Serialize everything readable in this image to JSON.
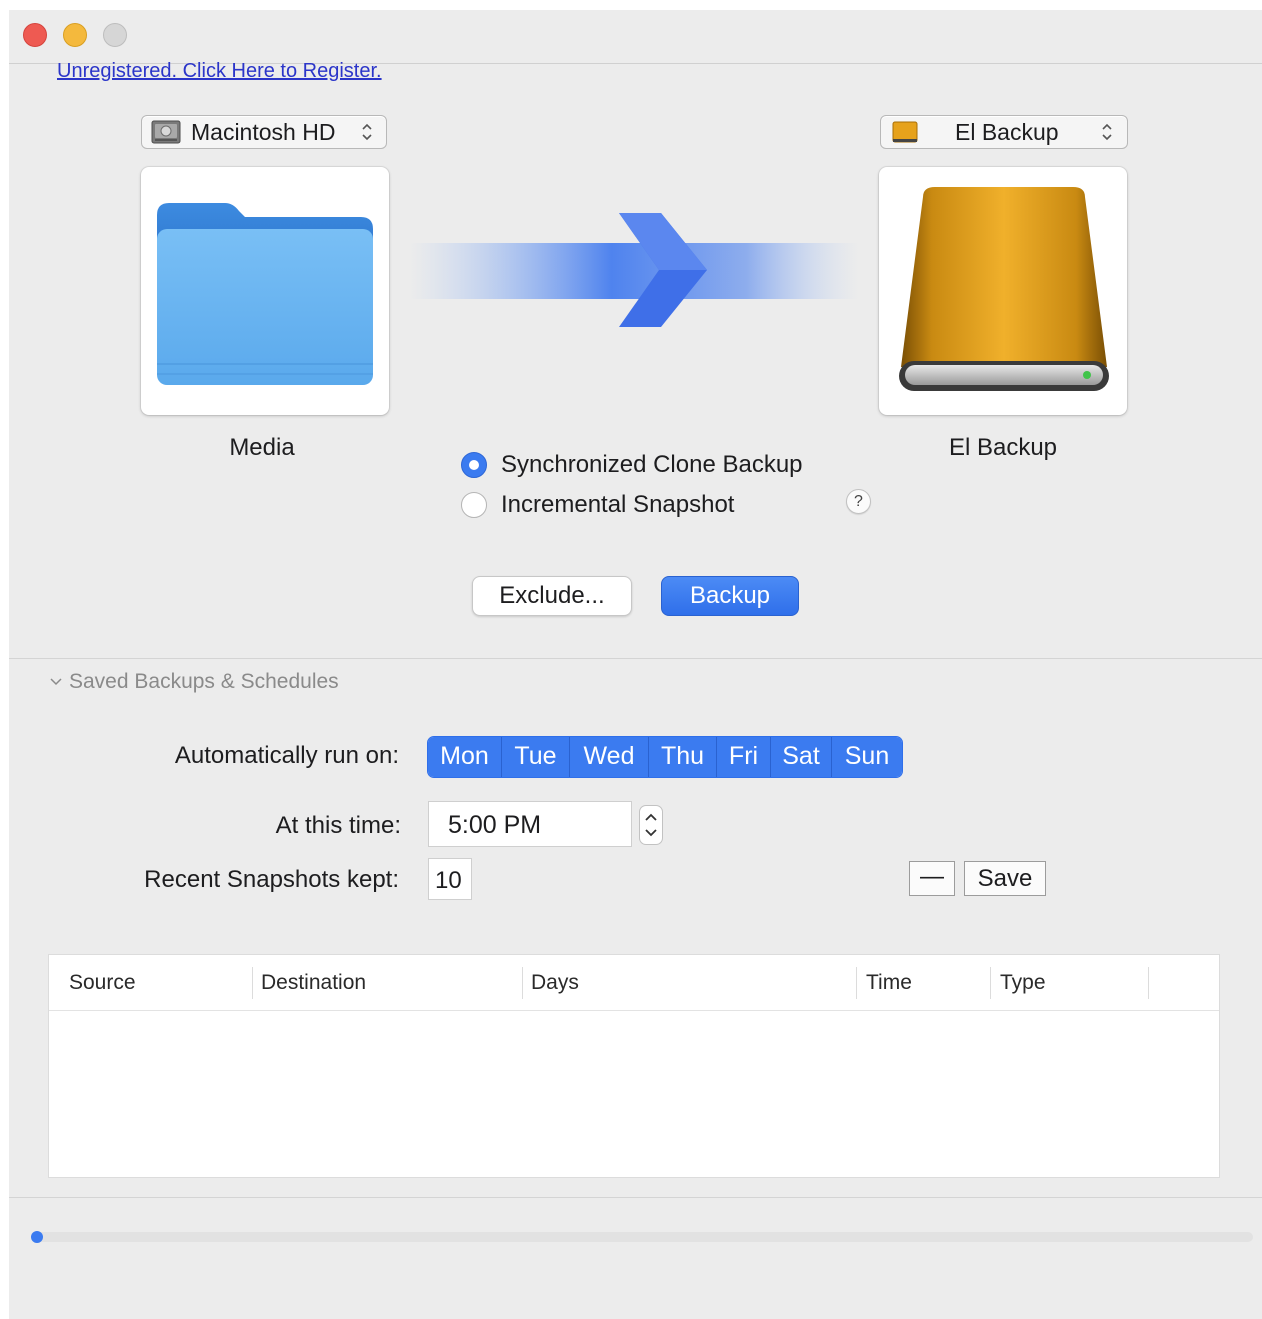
{
  "register_link": "Unregistered. Click Here to Register.",
  "source": {
    "popup_label": "Macintosh HD",
    "name": "Media",
    "icon": "folder-icon"
  },
  "destination": {
    "popup_label": "El Backup",
    "name": "El Backup",
    "icon": "external-drive-icon"
  },
  "backup_modes": [
    {
      "label": "Synchronized Clone Backup",
      "selected": true
    },
    {
      "label": "Incremental Snapshot",
      "selected": false
    }
  ],
  "help_label": "?",
  "buttons": {
    "exclude": "Exclude...",
    "backup": "Backup"
  },
  "schedules": {
    "section_title": "Saved Backups & Schedules",
    "run_on_label": "Automatically run on:",
    "days": [
      "Mon",
      "Tue",
      "Wed",
      "Thu",
      "Fri",
      "Sat",
      "Sun"
    ],
    "time_label": "At this time:",
    "time_value": "5:00 PM",
    "snapshots_label": "Recent Snapshots kept:",
    "snapshots_value": "10",
    "remove_label": "—",
    "save_label": "Save"
  },
  "table": {
    "columns": [
      "Source",
      "Destination",
      "Days",
      "Time",
      "Type"
    ],
    "rows": []
  },
  "colors": {
    "accent": "#3b7bf0",
    "link": "#2b35c9",
    "drive_gold": "#e6a21c",
    "folder_blue": "#6cb6f2"
  }
}
